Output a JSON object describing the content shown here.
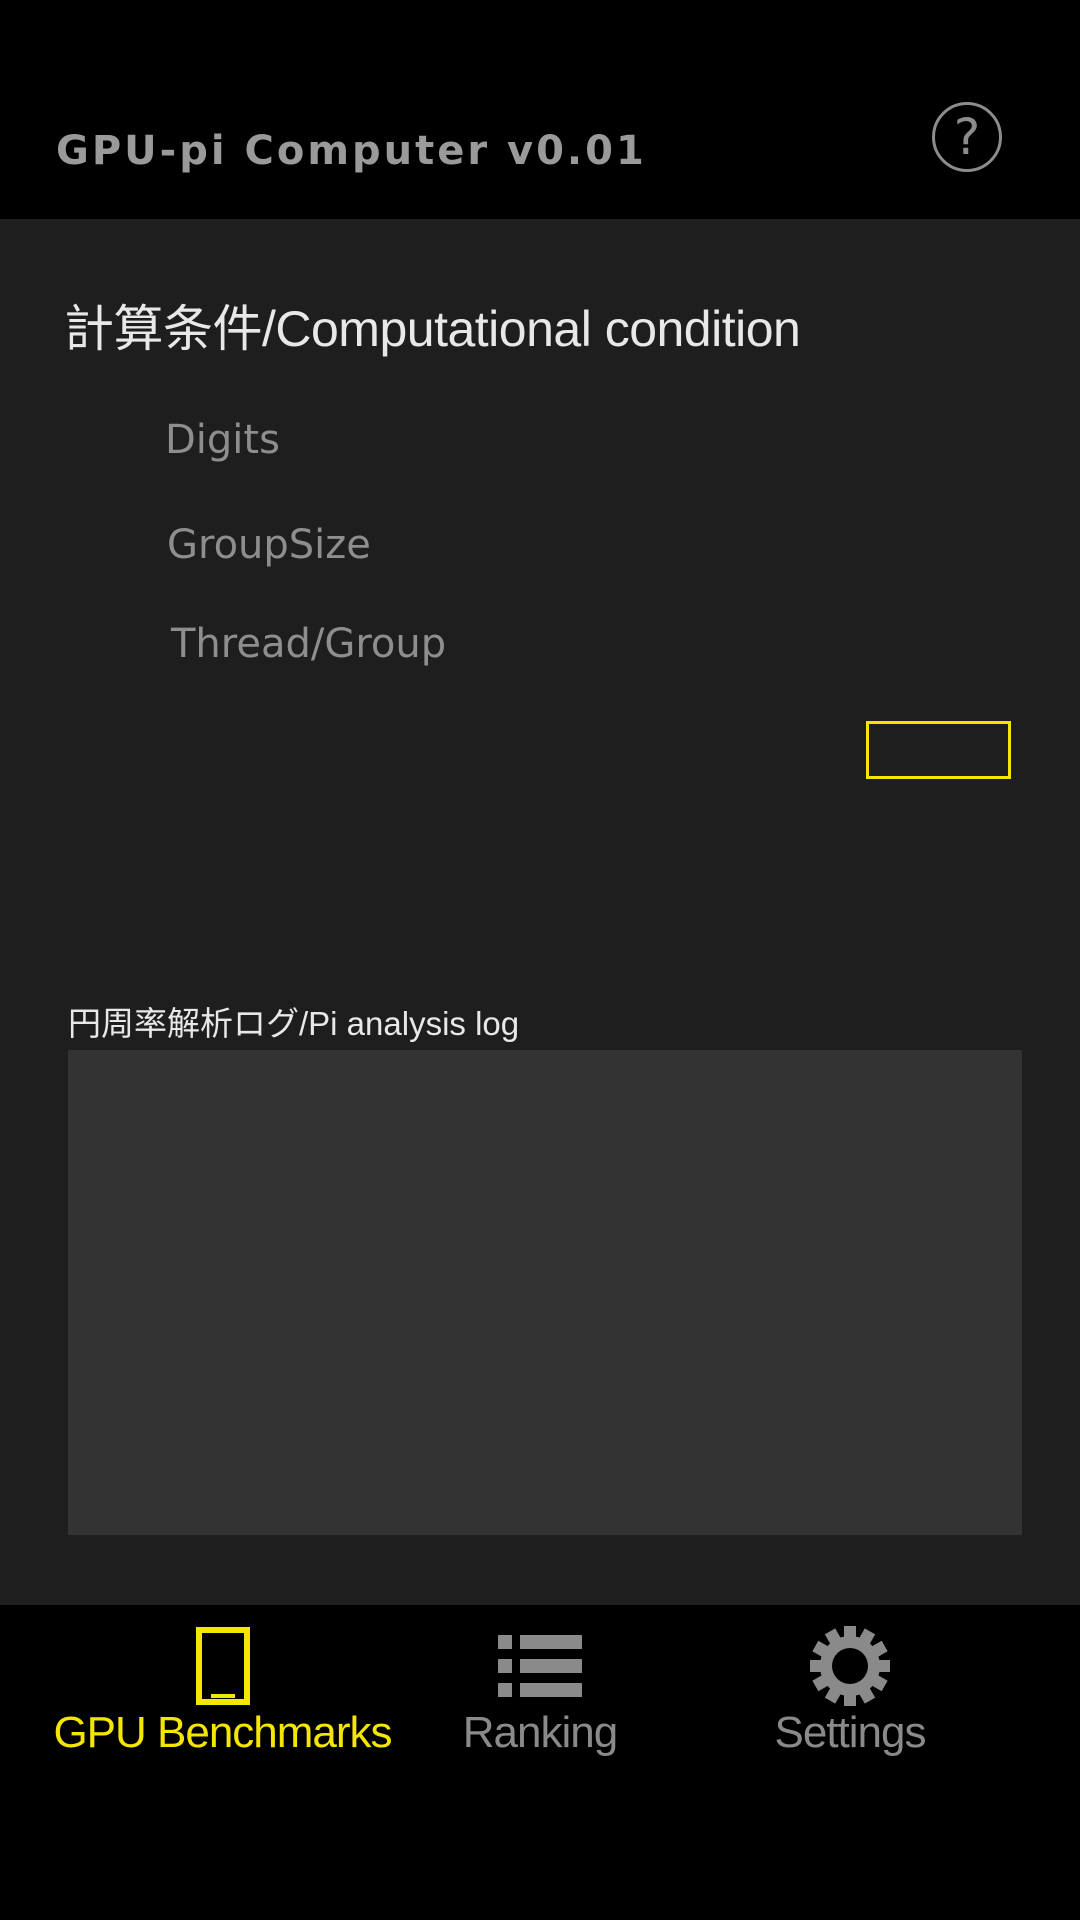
{
  "header": {
    "title": "GPU-pi Computer v0.01",
    "help_icon": "question-circle-icon",
    "help_glyph": "?"
  },
  "condition": {
    "title": "計算条件/Computational condition",
    "digits_label": "Digits",
    "groupsize_label": "GroupSize",
    "thread_label": "Thread/Group"
  },
  "log": {
    "title": "円周率解析ログ/Pi analysis log"
  },
  "tabs": [
    {
      "label": "GPU Benchmarks",
      "icon": "phone-icon",
      "active": true
    },
    {
      "label": "Ranking",
      "icon": "list-icon",
      "active": false
    },
    {
      "label": "Settings",
      "icon": "gear-icon",
      "active": false
    }
  ],
  "colors": {
    "accent": "#f5e600",
    "inactive": "#8a8a8a",
    "background": "#1e1e1e",
    "log_background": "#333333"
  }
}
